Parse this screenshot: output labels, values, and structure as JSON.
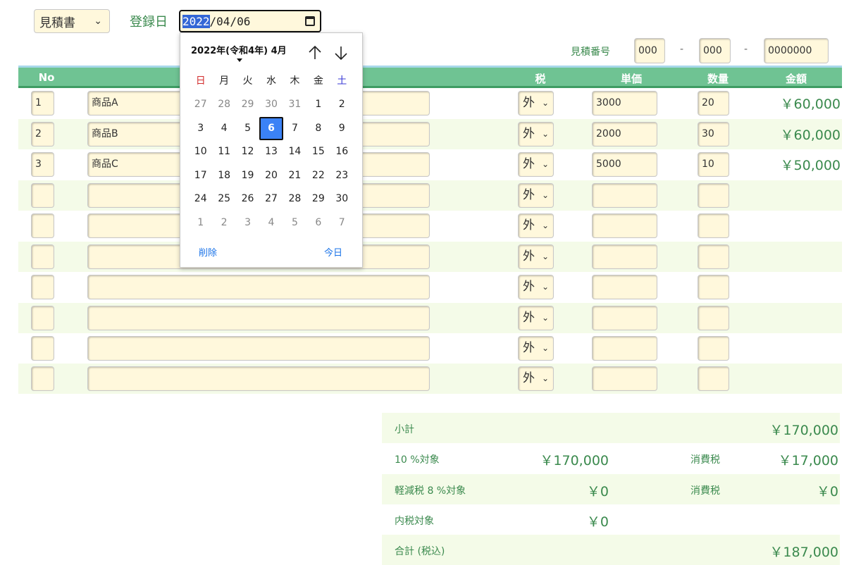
{
  "header": {
    "doc_type": "見積書",
    "reg_label": "登録日",
    "date_year": "2022",
    "date_rest": "/04/06",
    "estimate_label": "見積番号",
    "estimate_no": [
      "000",
      "000",
      "0000000"
    ],
    "dash": "-"
  },
  "table": {
    "headers": {
      "no": "No",
      "tax": "税",
      "price": "単価",
      "qty": "数量",
      "amount": "金額"
    },
    "rows": [
      {
        "no": "1",
        "name": "商品A",
        "tax": "外",
        "price": "3000",
        "qty": "20",
        "amount": "￥60,000"
      },
      {
        "no": "2",
        "name": "商品B",
        "tax": "外",
        "price": "2000",
        "qty": "30",
        "amount": "￥60,000"
      },
      {
        "no": "3",
        "name": "商品C",
        "tax": "外",
        "price": "5000",
        "qty": "10",
        "amount": "￥50,000"
      },
      {
        "no": "",
        "name": "",
        "tax": "外",
        "price": "",
        "qty": "",
        "amount": ""
      },
      {
        "no": "",
        "name": "",
        "tax": "外",
        "price": "",
        "qty": "",
        "amount": ""
      },
      {
        "no": "",
        "name": "",
        "tax": "外",
        "price": "",
        "qty": "",
        "amount": ""
      },
      {
        "no": "",
        "name": "",
        "tax": "外",
        "price": "",
        "qty": "",
        "amount": ""
      },
      {
        "no": "",
        "name": "",
        "tax": "外",
        "price": "",
        "qty": "",
        "amount": ""
      },
      {
        "no": "",
        "name": "",
        "tax": "外",
        "price": "",
        "qty": "",
        "amount": ""
      },
      {
        "no": "",
        "name": "",
        "tax": "外",
        "price": "",
        "qty": "",
        "amount": ""
      }
    ]
  },
  "summary": {
    "subtotal_label": "小計",
    "subtotal": "￥170,000",
    "ten_label": "10 %対象",
    "ten_value": "￥170,000",
    "tax_label": "消費税",
    "ten_tax": "￥17,000",
    "reduced_label": "軽減税 8 %対象",
    "reduced_value": "￥0",
    "reduced_tax": "￥0",
    "inner_label": "内税対象",
    "inner_value": "￥0",
    "total_label": "合計 (税込)",
    "total": "￥187,000"
  },
  "calendar": {
    "month_label": "2022年(令和4年) 4月",
    "weekdays": [
      "日",
      "月",
      "火",
      "水",
      "木",
      "金",
      "土"
    ],
    "weeks": [
      [
        "27",
        "28",
        "29",
        "30",
        "31",
        "1",
        "2"
      ],
      [
        "3",
        "4",
        "5",
        "6",
        "7",
        "8",
        "9"
      ],
      [
        "10",
        "11",
        "12",
        "13",
        "14",
        "15",
        "16"
      ],
      [
        "17",
        "18",
        "19",
        "20",
        "21",
        "22",
        "23"
      ],
      [
        "24",
        "25",
        "26",
        "27",
        "28",
        "29",
        "30"
      ],
      [
        "1",
        "2",
        "3",
        "4",
        "5",
        "6",
        "7"
      ]
    ],
    "selected_day": "6",
    "clear_label": "削除",
    "today_label": "今日"
  },
  "colors": {
    "accent_green": "#3b8a4e",
    "header_green": "#6fc393",
    "field_bg": "#fff8dc",
    "row_alt_bg": "#f4fbe8",
    "selected_blue": "#3b82f6"
  }
}
